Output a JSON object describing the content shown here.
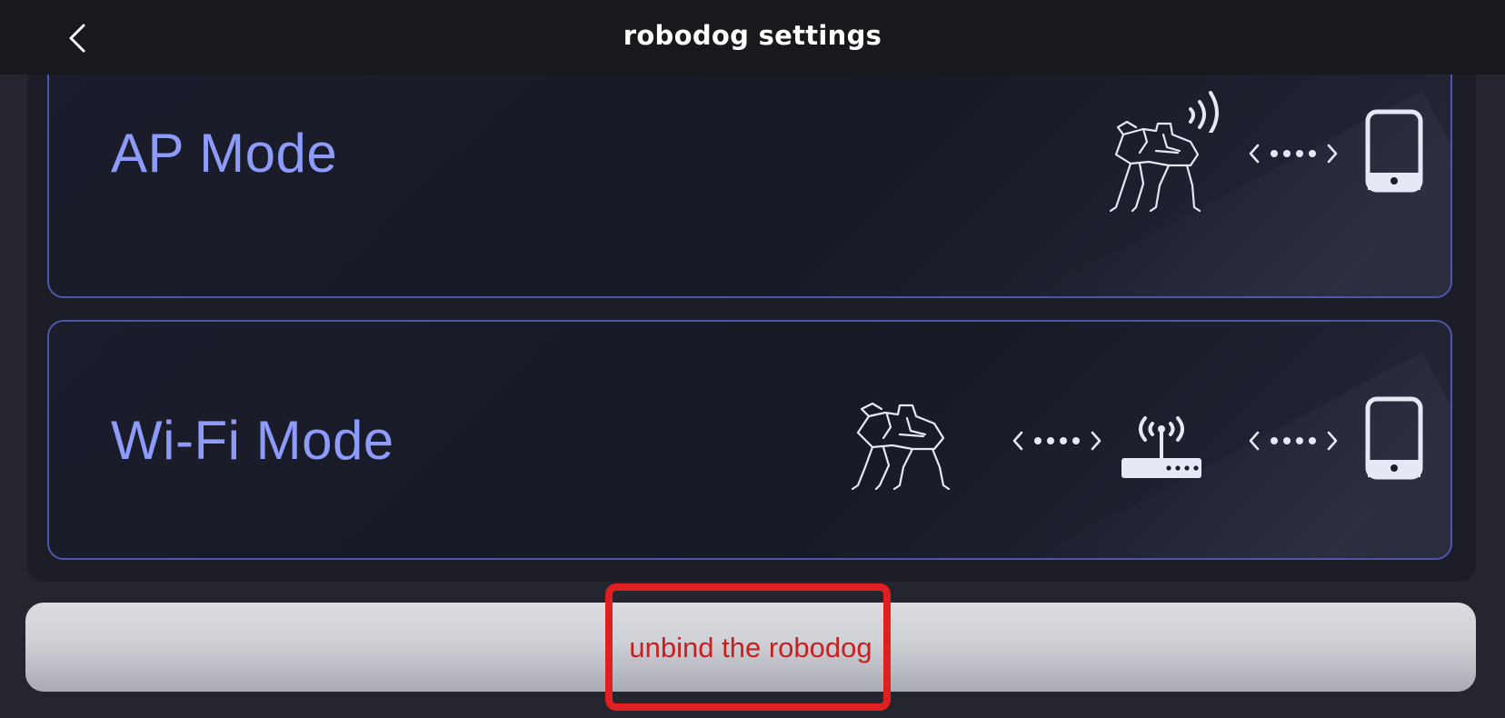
{
  "header": {
    "title": "robodog settings",
    "back_icon": "chevron-left-icon"
  },
  "modes": [
    {
      "label": "AP Mode",
      "icons": [
        "robot-dog-icon",
        "wireless-signal-icon",
        "connection-dots-icon",
        "phone-icon"
      ]
    },
    {
      "label": "Wi-Fi Mode",
      "icons": [
        "robot-dog-icon",
        "connection-dots-icon",
        "router-icon",
        "connection-dots-icon",
        "phone-icon"
      ]
    }
  ],
  "actions": {
    "unbind_label": "unbind the robodog"
  },
  "colors": {
    "background": "#24252e",
    "header": "#18181d",
    "accent": "#8d9bfa",
    "card_border": "#4c57ab",
    "danger_text": "#c81f1f",
    "highlight": "#e02020"
  }
}
